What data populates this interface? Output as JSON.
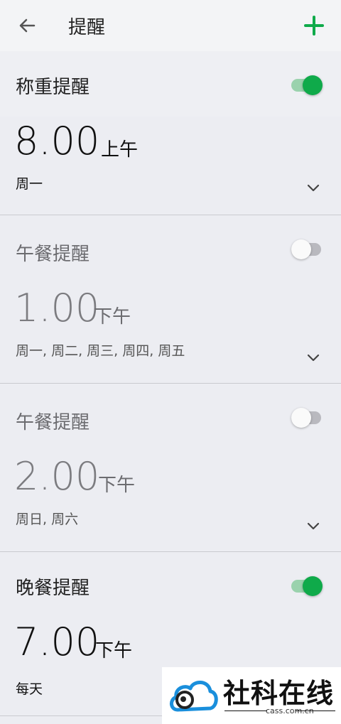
{
  "appbar": {
    "title": "提醒"
  },
  "reminders": [
    {
      "title": "称重提醒",
      "enabled": true,
      "time": "8.00",
      "ampm": "上午",
      "days": "周一"
    },
    {
      "title": "午餐提醒",
      "enabled": false,
      "time": "1.00",
      "ampm": "下午",
      "days": "周一, 周二, 周三, 周四, 周五"
    },
    {
      "title": "午餐提醒",
      "enabled": false,
      "time": "2.00",
      "ampm": "下午",
      "days": "周日, 周六"
    },
    {
      "title": "晚餐提醒",
      "enabled": true,
      "time": "7.00",
      "ampm": "下午",
      "days": "每天"
    }
  ],
  "watermark": {
    "name": "社科在线",
    "domain": "cass.com.cn"
  },
  "colors": {
    "accent": "#0faa4a",
    "accent_track": "#9ad2ad",
    "background": "#ecedf2"
  },
  "icons": {
    "back": "arrow-left-icon",
    "add": "plus-icon",
    "expand": "chevron-down-icon"
  }
}
